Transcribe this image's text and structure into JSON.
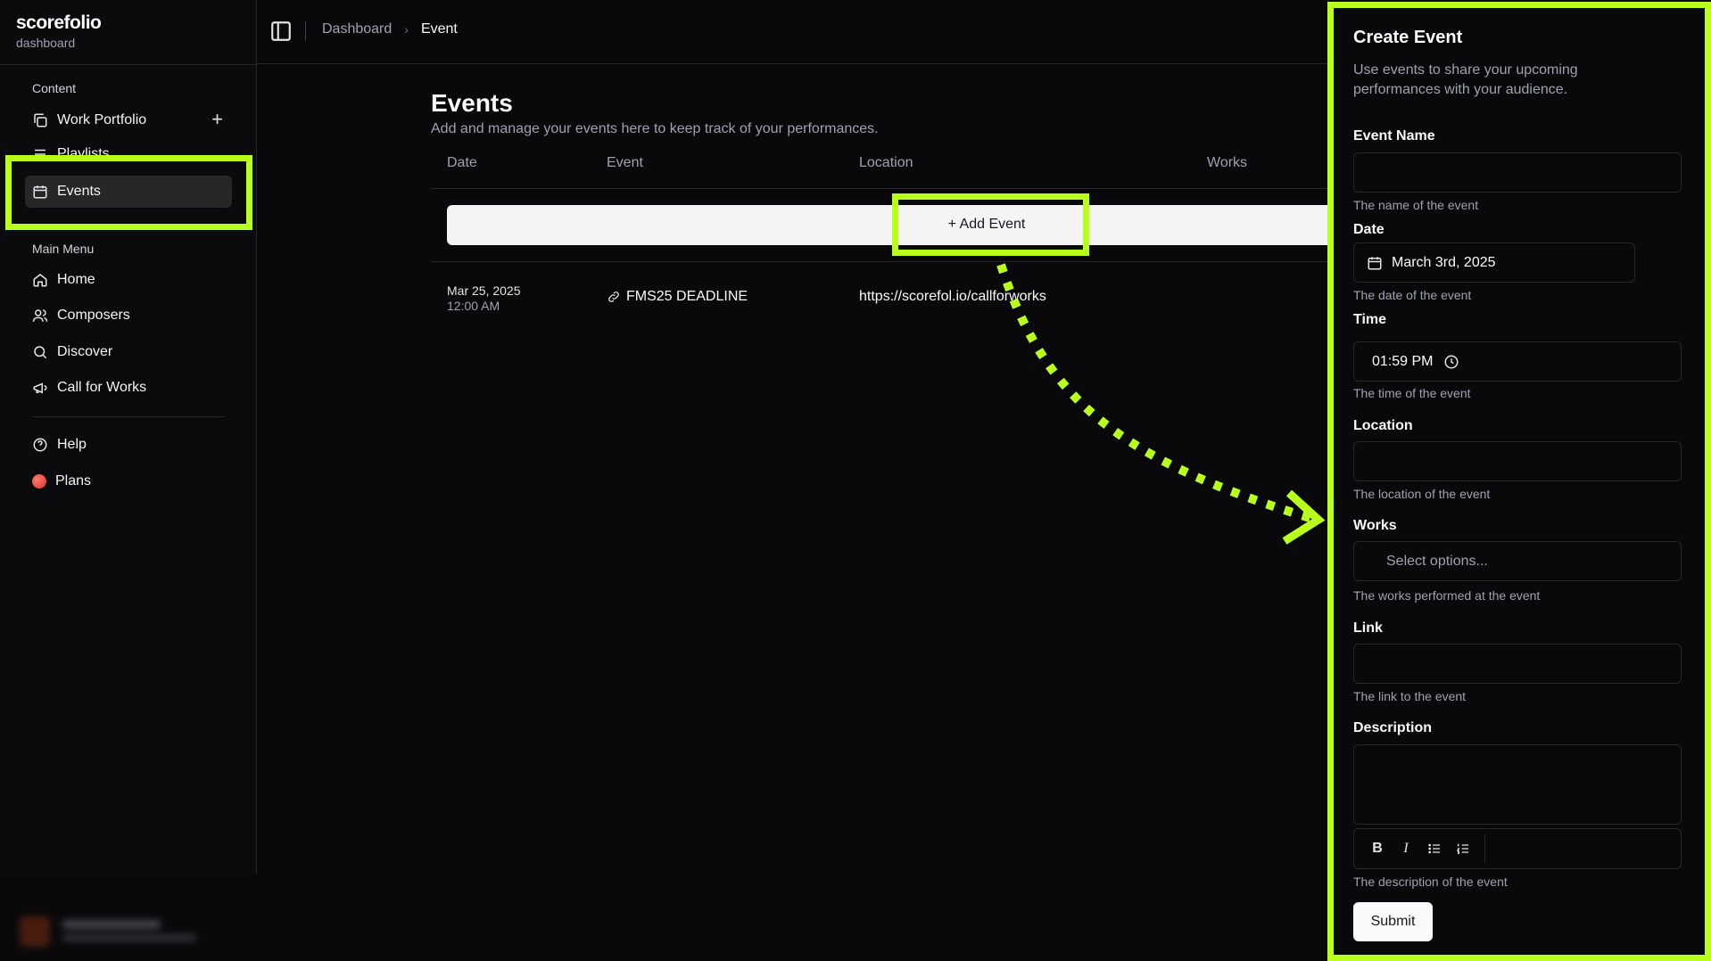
{
  "brand": {
    "name": "scorefolio",
    "sub": "dashboard"
  },
  "sidebar": {
    "content_label": "Content",
    "content_items": [
      {
        "label": "Work Portfolio",
        "icon": "copy-icon"
      },
      {
        "label": "Playlists",
        "icon": "list-icon"
      },
      {
        "label": "Events",
        "icon": "calendar-icon",
        "active": true
      }
    ],
    "main_label": "Main Menu",
    "main_items": [
      {
        "label": "Home",
        "icon": "home-icon"
      },
      {
        "label": "Composers",
        "icon": "users-icon"
      },
      {
        "label": "Discover",
        "icon": "search-icon"
      },
      {
        "label": "Call for Works",
        "icon": "megaphone-icon"
      }
    ],
    "extra_items": [
      {
        "label": "Help",
        "icon": "help-circle-icon"
      },
      {
        "label": "Plans",
        "icon": "plans-dot-icon"
      }
    ]
  },
  "header": {
    "breadcrumb": [
      "Dashboard",
      "Event"
    ]
  },
  "main": {
    "title": "Events",
    "subtitle": "Add and manage your events here to keep track of your performances.",
    "columns": [
      "Date",
      "Event",
      "Location",
      "Works"
    ],
    "add_label": "+ Add Event",
    "rows": [
      {
        "date": "Mar 25, 2025",
        "time": "12:00 AM",
        "event": "FMS25 DEADLINE",
        "location": "https://scorefol.io/callforworks"
      }
    ]
  },
  "panel": {
    "title": "Create Event",
    "subtitle": "Use events to share your upcoming performances with your audience.",
    "fields": {
      "name": {
        "label": "Event Name",
        "value": "",
        "help": "The name of the event"
      },
      "date": {
        "label": "Date",
        "value": "March 3rd, 2025",
        "help": "The date of the event"
      },
      "time": {
        "label": "Time",
        "value": "01:59 PM",
        "help": "The time of the event"
      },
      "location": {
        "label": "Location",
        "value": "",
        "help": "The location of the event"
      },
      "works": {
        "label": "Works",
        "placeholder": "Select options...",
        "help": "The works performed at the event"
      },
      "link": {
        "label": "Link",
        "value": "",
        "help": "The link to the event"
      },
      "description": {
        "label": "Description",
        "value": "",
        "help": "The description of the event"
      }
    },
    "toolbar": [
      "B",
      "I",
      "bullet-list-icon",
      "ordered-list-icon"
    ],
    "submit_label": "Submit"
  },
  "colors": {
    "highlight": "#b8ff1c",
    "background": "#09090b"
  }
}
